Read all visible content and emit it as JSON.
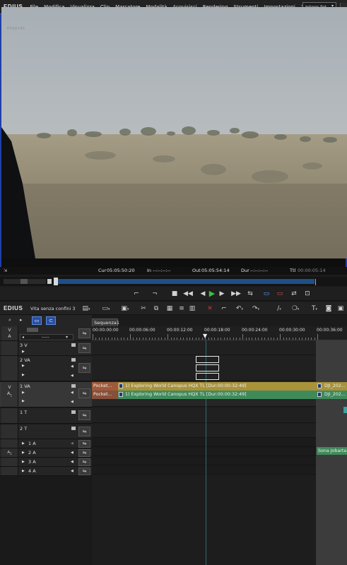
{
  "app": {
    "logo": "EDIUS",
    "menu": [
      "File",
      "Modifica",
      "Visualizza",
      "Clip",
      "Marcatore",
      "Modalità",
      "Acquisisci",
      "Rendering",
      "Strumenti",
      "Impostazioni",
      "?"
    ],
    "fit_select": "Intero fot..."
  },
  "player": {
    "watermark": "PVS0791",
    "cur_label": "Cur",
    "cur_value": "05:05:50:20",
    "in_label": "In",
    "in_value": "--:--:--:--",
    "out_label": "Out",
    "out_value": "05:05:54:14",
    "dur_label": "Dur",
    "dur_value": "--:--:--:--",
    "ttl_label": "Ttl",
    "ttl_value": "00:00:05:14"
  },
  "timeline": {
    "logo": "EDIUS",
    "project": "Vita senza confini 3",
    "sequence_tab": "Sequenza1",
    "ruler_labels": [
      "00:00:00:00",
      "00:00:06:00",
      "00:00:12:00",
      "00:00:18:00",
      "00:00:24:00",
      "00:00:30:00",
      "00:00:36:00"
    ],
    "tracks": {
      "vtrack_dropdown": "-----",
      "v3": "3 V",
      "va2": "2 VA",
      "va1": "1 VA",
      "t1": "1 T",
      "t2": "2 T",
      "a1": "1 A",
      "a2": "2 A",
      "a3": "3 A",
      "a4": "4 A",
      "patch_v": "V",
      "patch_a": "A",
      "patch_a1": "A",
      "patch_a1_sub": "1"
    },
    "clips": {
      "video_pocket": "Pocket...",
      "audio_pocket": "Pocket...",
      "video_main": "1) Exploring World Canopus HQX  TL [Dur:00:00:32:49]",
      "audio_main": "1) Exploring World Canopus HQX  TL [Dur:00:00:32:49]",
      "video_dji": "DJI_202...",
      "audio_dji": "DJI_202...",
      "audio_music": "Sona Jobarta"
    }
  }
}
